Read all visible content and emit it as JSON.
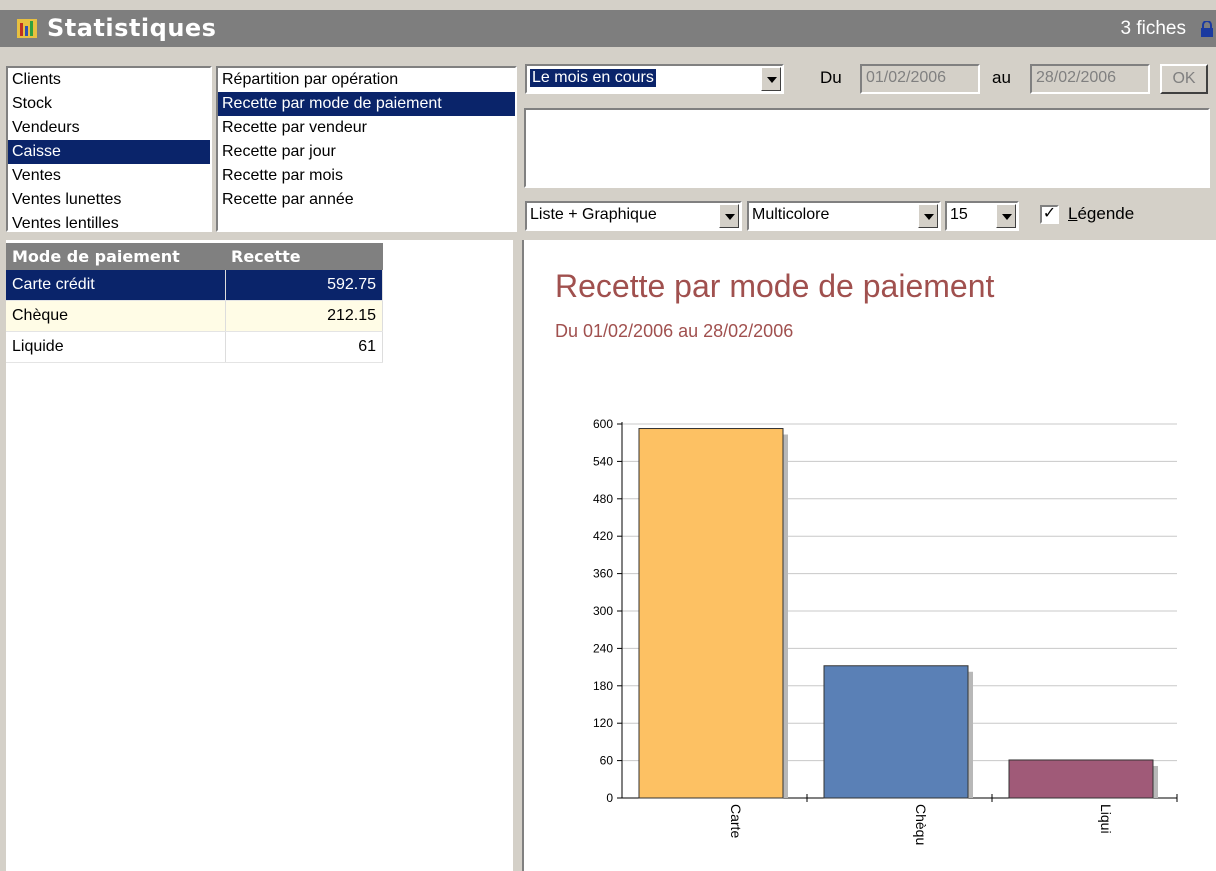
{
  "window": {
    "title": "Statistiques",
    "record_count": "3 fiches"
  },
  "categories": {
    "items": [
      "Clients",
      "Stock",
      "Vendeurs",
      "Caisse",
      "Ventes",
      "Ventes lunettes",
      "Ventes lentilles"
    ],
    "selected": "Caisse"
  },
  "reports": {
    "items": [
      "Répartition par opération",
      "Recette par mode de paiement",
      "Recette par vendeur",
      "Recette par jour",
      "Recette par mois",
      "Recette par année"
    ],
    "selected": "Recette par mode de paiement"
  },
  "period": {
    "selected": "Le mois en cours",
    "du_label": "Du",
    "from": "01/02/2006",
    "au_label": "au",
    "to": "28/02/2006",
    "ok_label": "OK"
  },
  "display": {
    "view": "Liste + Graphique",
    "color_scheme": "Multicolore",
    "size": "15",
    "legend_checked": true,
    "legend_label_first": "L",
    "legend_label_rest": "égende"
  },
  "table": {
    "headers": [
      "Mode de paiement",
      "Recette"
    ],
    "rows": [
      {
        "mode": "Carte crédit",
        "recette": "592.75"
      },
      {
        "mode": "Chèque",
        "recette": "212.15"
      },
      {
        "mode": "Liquide",
        "recette": "61"
      }
    ]
  },
  "chart_data": {
    "type": "bar",
    "title": "Recette par mode de paiement",
    "subtitle": "Du 01/02/2006 au 28/02/2006",
    "categories": [
      "Carte",
      "Chèqu",
      "Liqui"
    ],
    "values": [
      592.75,
      212.15,
      61
    ],
    "colors": [
      "#fdc163",
      "#5a80b6",
      "#a05a78"
    ],
    "ylim": [
      0,
      600
    ],
    "yticks": [
      0,
      60,
      120,
      180,
      240,
      300,
      360,
      420,
      480,
      540,
      600
    ],
    "grid": true
  },
  "colors": {
    "selection": "#0a246a",
    "title_accent": "#a0504e",
    "titlebar": "#7e7e7e"
  }
}
